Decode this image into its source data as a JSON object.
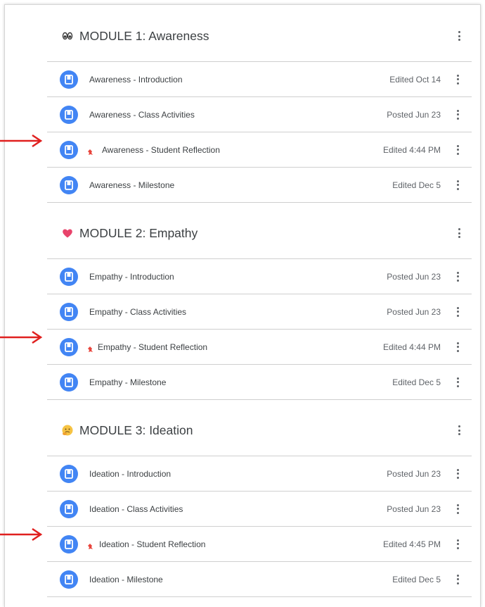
{
  "modules": [
    {
      "title": "MODULE 1: Awareness",
      "emoji": "eyes-icon",
      "items": [
        {
          "title": "Awareness - Introduction",
          "date": "Edited Oct 14",
          "pinned": false
        },
        {
          "title": "Awareness - Class Activities",
          "date": "Posted Jun 23",
          "pinned": false
        },
        {
          "title": "Awareness - Student Reflection",
          "date": "Edited 4:44 PM",
          "pinned": true
        },
        {
          "title": "Awareness - Milestone",
          "date": "Edited Dec 5",
          "pinned": false
        }
      ]
    },
    {
      "title": "MODULE 2: Empathy",
      "emoji": "heart-icon",
      "items": [
        {
          "title": "Empathy - Introduction",
          "date": "Posted Jun 23",
          "pinned": false
        },
        {
          "title": "Empathy - Class Activities",
          "date": "Posted Jun 23",
          "pinned": false
        },
        {
          "title": "Empathy - Student Reflection",
          "date": "Edited 4:44 PM",
          "pinned": true
        },
        {
          "title": "Empathy - Milestone",
          "date": "Edited Dec 5",
          "pinned": false
        }
      ]
    },
    {
      "title": "MODULE 3: Ideation",
      "emoji": "thinking-face-icon",
      "items": [
        {
          "title": "Ideation - Introduction",
          "date": "Posted Jun 23",
          "pinned": false
        },
        {
          "title": "Ideation - Class Activities",
          "date": "Posted Jun 23",
          "pinned": false
        },
        {
          "title": "Ideation - Student Reflection",
          "date": "Edited 4:45 PM",
          "pinned": true
        },
        {
          "title": "Ideation - Milestone",
          "date": "Edited Dec 5",
          "pinned": false
        }
      ]
    }
  ],
  "colors": {
    "doc_icon": "#4285f4",
    "arrow": "#e0201f",
    "pin": "#e8453c",
    "divider": "#cfcfcf"
  }
}
